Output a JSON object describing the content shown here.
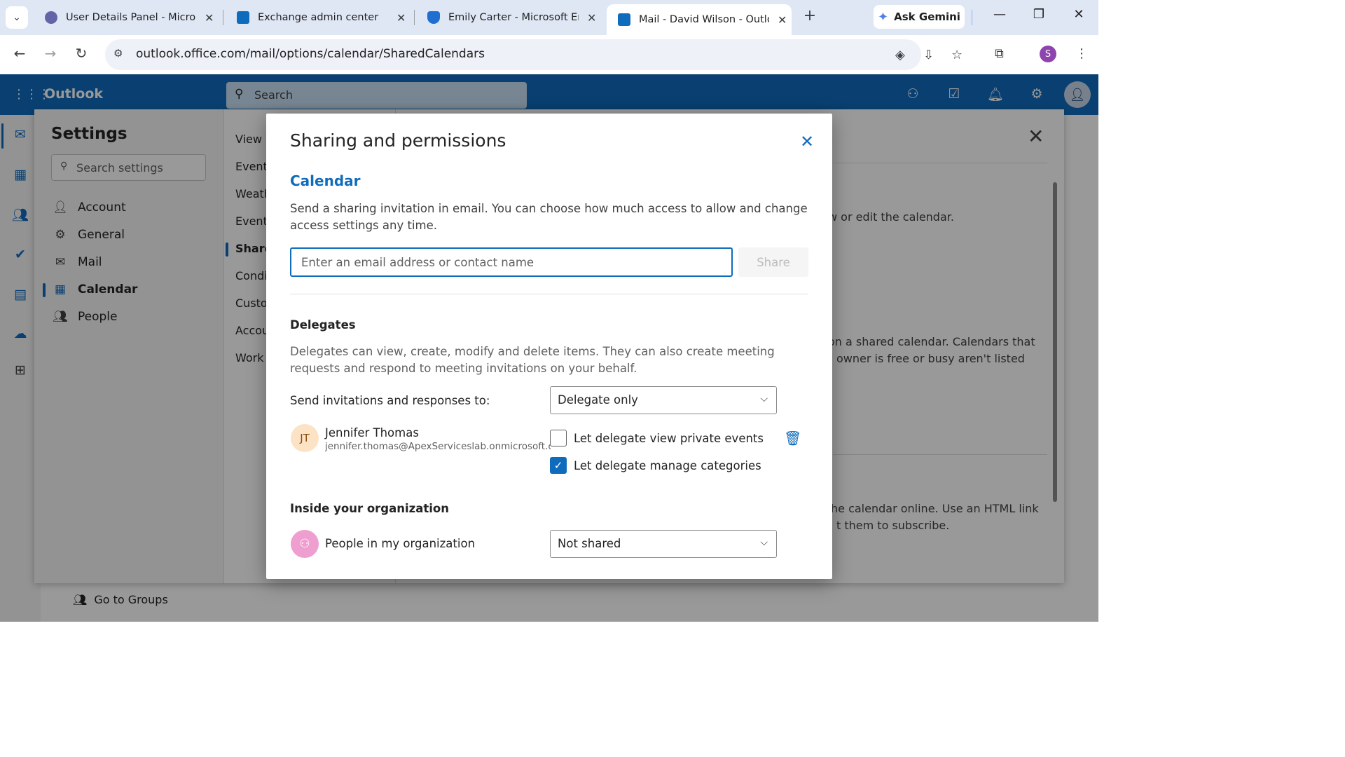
{
  "browser": {
    "tabs": [
      {
        "label": "User Details Panel - Microsof",
        "icon": "gear-icon",
        "color": "#6264a7"
      },
      {
        "label": "Exchange admin center",
        "icon": "exchange-icon",
        "color": "#0f6cbd"
      },
      {
        "label": "Emily Carter - Microsoft Entr",
        "icon": "entra-icon",
        "color": "#1f6fd1"
      },
      {
        "label": "Mail - David Wilson - Outloo",
        "icon": "outlook-icon",
        "color": "#0f6cbd"
      }
    ],
    "new_tab": "+",
    "gemini_label": "Ask Gemini",
    "url": "outlook.office.com/mail/options/calendar/SharedCalendars",
    "profile_initial": "S"
  },
  "owa": {
    "brand": "Outlook",
    "search_placeholder": "Search",
    "go_to_groups": "Go to Groups"
  },
  "settings": {
    "title": "Settings",
    "search_placeholder": "Search settings",
    "nav": [
      {
        "label": "Account",
        "icon": "person-icon"
      },
      {
        "label": "General",
        "icon": "gear-icon"
      },
      {
        "label": "Mail",
        "icon": "mail-icon"
      },
      {
        "label": "Calendar",
        "icon": "calendar-icon"
      },
      {
        "label": "People",
        "icon": "people-icon"
      }
    ],
    "active_nav": "Calendar",
    "sub_nav": [
      "View",
      "Events",
      "Weath",
      "Events",
      "Share",
      "Condi",
      "Custo",
      "Accou",
      "Work"
    ],
    "active_sub_nav": "Share",
    "background_text": [
      "w or edit the calendar.",
      "on a shared calendar. Calendars that",
      "owner is free or busy aren't listed",
      "he calendar online. Use an HTML link",
      "t them to subscribe."
    ]
  },
  "dialog": {
    "title": "Sharing and permissions",
    "calendar_heading": "Calendar",
    "intro": "Send a sharing invitation in email. You can choose how much access to allow and change access settings any time.",
    "email_placeholder": "Enter an email address or contact name",
    "share_label": "Share",
    "delegates_heading": "Delegates",
    "delegates_desc": "Delegates can view, create, modify and delete items. They can also create meeting requests and respond to meeting invitations on your behalf.",
    "send_invitations_label": "Send invitations and responses to:",
    "send_invitations_value": "Delegate only",
    "delegate": {
      "initials": "JT",
      "name": "Jennifer Thomas",
      "email": "jennifer.thomas@ApexServiceslab.onmicrosoft.c..."
    },
    "view_private_label": "Let delegate view private events",
    "view_private_checked": false,
    "manage_categories_label": "Let delegate manage categories",
    "manage_categories_checked": true,
    "inside_org_heading": "Inside your organization",
    "org_row_label": "People in my organization",
    "org_row_value": "Not shared"
  },
  "colors": {
    "accent": "#0f6cbd",
    "delegate_avatar_bg": "#fde3c6",
    "org_avatar_bg": "#ef9fcf"
  }
}
